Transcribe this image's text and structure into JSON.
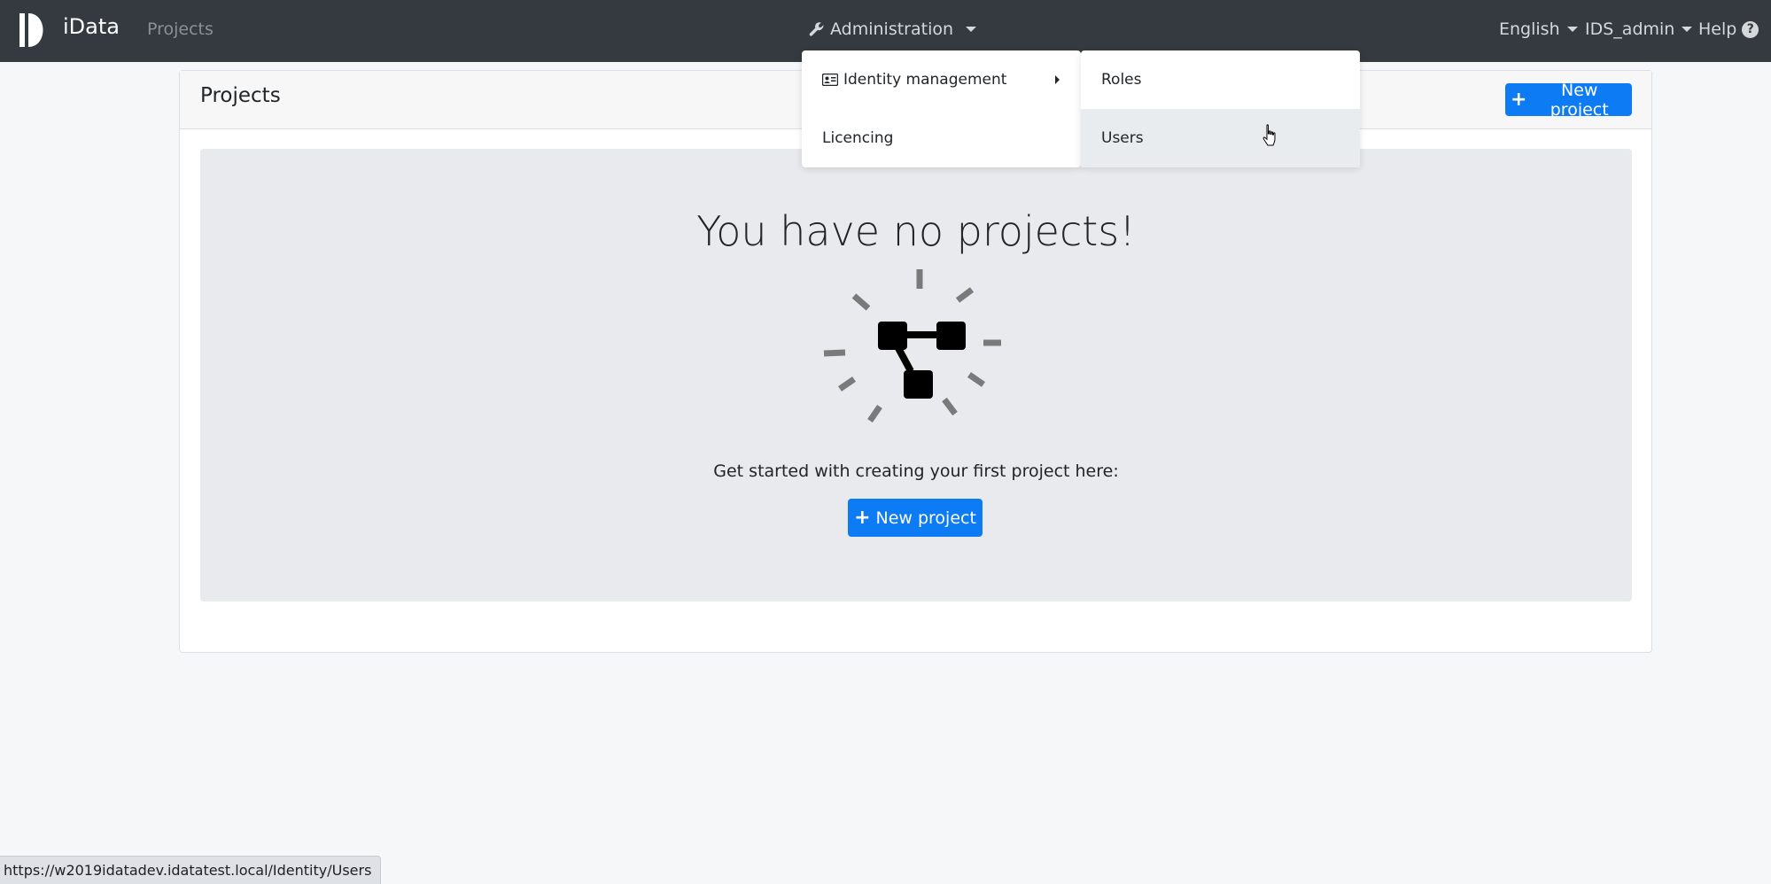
{
  "navbar": {
    "brand": "iData",
    "projects_link": "Projects",
    "admin_label": "Administration",
    "language_label": "English",
    "user_label": "IDS_admin",
    "help_label": "Help"
  },
  "admin_menu": {
    "items": [
      {
        "label": "Identity management",
        "icon": "id-card-icon",
        "has_submenu": true
      },
      {
        "label": "Licencing"
      }
    ],
    "submenu": [
      {
        "label": "Roles"
      },
      {
        "label": "Users",
        "hovered": true
      }
    ]
  },
  "card": {
    "title": "Projects",
    "new_project_label": "New project"
  },
  "empty_state": {
    "title": "You have no projects!",
    "text": "Get started with creating your first project here:",
    "button_label": "New project",
    "illustration_icon": "project-hierarchy-icon"
  },
  "status_bar": {
    "url": "https://w2019idatadev.idatatest.local/Identity/Users"
  },
  "colors": {
    "navbar_bg": "#343a40",
    "primary": "#0d7bf4",
    "page_bg": "#f6f7f9",
    "jumbotron_bg": "#e8eaed"
  }
}
